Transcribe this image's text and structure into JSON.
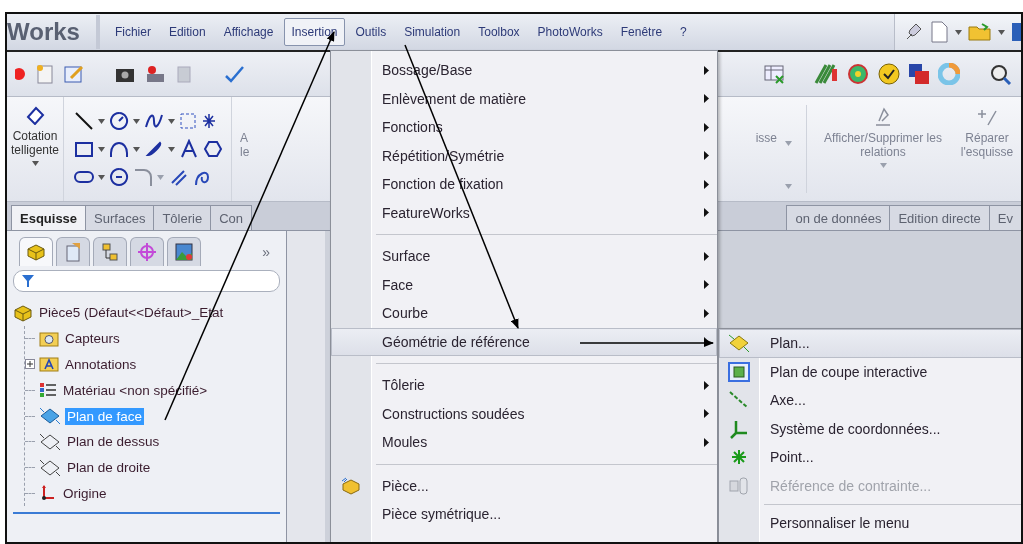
{
  "app_title": "Works",
  "menubar": [
    {
      "label": "Fichier",
      "selected": false
    },
    {
      "label": "Edition",
      "selected": false
    },
    {
      "label": "Affichage",
      "selected": false
    },
    {
      "label": "Insertion",
      "selected": true
    },
    {
      "label": "Outils",
      "selected": false
    },
    {
      "label": "Simulation",
      "selected": false
    },
    {
      "label": "Toolbox",
      "selected": false
    },
    {
      "label": "PhotoWorks",
      "selected": false
    },
    {
      "label": "Fenêtre",
      "selected": false
    },
    {
      "label": "?",
      "selected": false
    }
  ],
  "ribbon": {
    "smart_dimension": [
      "Cotation",
      "telligente"
    ],
    "partial_label": [
      "A",
      "le"
    ],
    "partial_sketch": "isse",
    "relations": "Afficher/Supprimer les relations",
    "repair": "Réparer l'esquisse"
  },
  "tabs_left": [
    {
      "label": "Esquisse",
      "selected": true
    },
    {
      "label": "Surfaces",
      "selected": false
    },
    {
      "label": "Tôlerie",
      "selected": false
    },
    {
      "label": "Con",
      "selected": false
    }
  ],
  "tabs_right": [
    {
      "label": "on de données",
      "selected": false
    },
    {
      "label": "Edition directe",
      "selected": false
    },
    {
      "label": "Ev",
      "selected": false
    }
  ],
  "panel": {
    "tabs": [
      {
        "kind": "features",
        "selected": true
      },
      {
        "kind": "properties",
        "selected": false
      },
      {
        "kind": "configurations",
        "selected": false
      },
      {
        "kind": "dimxpert",
        "selected": false
      },
      {
        "kind": "display",
        "selected": false
      }
    ],
    "more": "»",
    "tree": {
      "label": "Pièce5 (Défaut<<Défaut>_Etat",
      "kind": "part",
      "children": [
        {
          "label": "Capteurs",
          "kind": "sensors",
          "selected": false
        },
        {
          "label": "Annotations",
          "kind": "annotations",
          "expanded": false,
          "selected": false
        },
        {
          "label": "Matériau <non spécifié>",
          "kind": "material",
          "selected": false
        },
        {
          "label": "Plan de face",
          "kind": "plane",
          "selected": true
        },
        {
          "label": "Plan de dessus",
          "kind": "plane",
          "selected": false
        },
        {
          "label": "Plan de droite",
          "kind": "plane",
          "selected": false
        },
        {
          "label": "Origine",
          "kind": "origin",
          "selected": false
        }
      ]
    }
  },
  "menu": {
    "groups": [
      [
        {
          "label": "Bossage/Base",
          "kind": "submenu",
          "selected": false
        },
        {
          "label": "Enlèvement de matière",
          "kind": "submenu",
          "selected": false
        },
        {
          "label": "Fonctions",
          "kind": "submenu",
          "selected": false
        },
        {
          "label": "Répétition/Symétrie",
          "kind": "submenu",
          "selected": false
        },
        {
          "label": "Fonction de fixation",
          "kind": "submenu",
          "selected": false
        },
        {
          "label": "FeatureWorks",
          "kind": "submenu",
          "selected": false
        }
      ],
      [
        {
          "label": "Surface",
          "kind": "submenu",
          "selected": false
        },
        {
          "label": "Face",
          "kind": "submenu",
          "selected": false
        },
        {
          "label": "Courbe",
          "kind": "submenu",
          "selected": false
        },
        {
          "label": "Géométrie de référence",
          "kind": "submenu",
          "selected": true
        }
      ],
      [
        {
          "label": "Tôlerie",
          "kind": "submenu",
          "selected": false
        },
        {
          "label": "Constructions soudées",
          "kind": "submenu",
          "selected": false
        },
        {
          "label": "Moules",
          "kind": "submenu",
          "selected": false
        }
      ],
      [
        {
          "label": "Pièce...",
          "kind": "part",
          "selected": false
        },
        {
          "label": "Pièce symétrique...",
          "kind": "action",
          "selected": false
        }
      ]
    ]
  },
  "submenu": {
    "groups": [
      [
        {
          "label": "Plan...",
          "kind": "plane",
          "selected": true,
          "disabled": false
        },
        {
          "label": "Plan de coupe interactive",
          "kind": "section",
          "selected": false,
          "disabled": false
        },
        {
          "label": "Axe...",
          "kind": "axis",
          "selected": false,
          "disabled": false
        },
        {
          "label": "Système de coordonnées...",
          "kind": "coords",
          "selected": false,
          "disabled": false
        },
        {
          "label": "Point...",
          "kind": "point",
          "selected": false,
          "disabled": false
        },
        {
          "label": "Référence de contrainte...",
          "kind": "mate",
          "selected": false,
          "disabled": true
        }
      ],
      [
        {
          "label": "Personnaliser le menu",
          "kind": "action",
          "selected": false,
          "disabled": false
        }
      ]
    ]
  }
}
